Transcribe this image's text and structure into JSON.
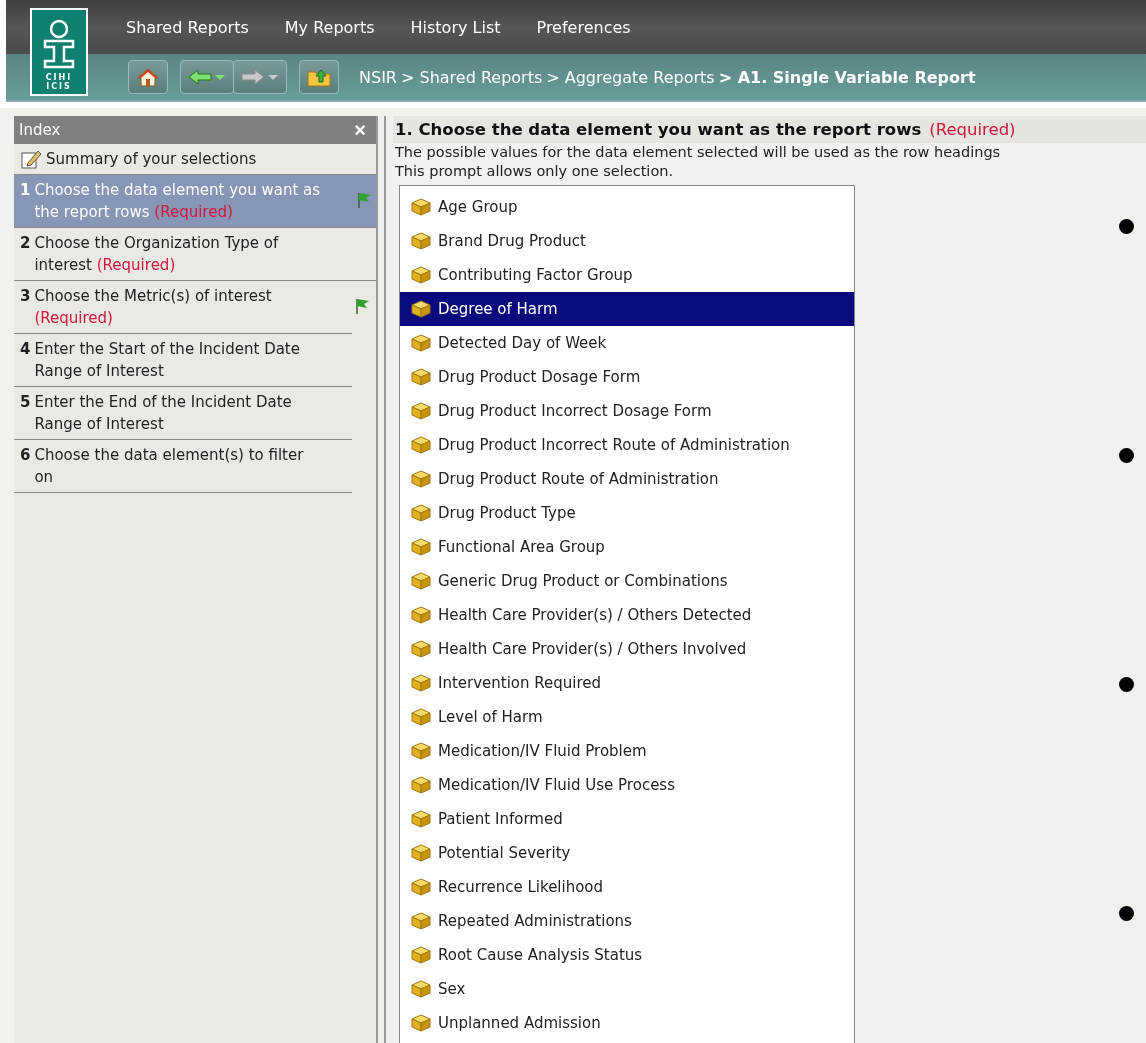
{
  "logo": {
    "lines": [
      "CIHI",
      "ICIS"
    ]
  },
  "nav": {
    "items": [
      {
        "label": "Shared Reports"
      },
      {
        "label": "My Reports"
      },
      {
        "label": "History List"
      },
      {
        "label": "Preferences"
      }
    ]
  },
  "toolbar": {
    "buttons": [
      {
        "kind": "home",
        "disabled": false
      },
      {
        "kind": "back",
        "disabled": false
      },
      {
        "kind": "forward",
        "disabled": true
      },
      {
        "kind": "folder-up",
        "disabled": false
      }
    ]
  },
  "breadcrumb": [
    {
      "label": "NSIR",
      "current": false
    },
    {
      "label": "Shared Reports",
      "prefix": ">",
      "current": false
    },
    {
      "label": "Aggregate Reports",
      "prefix": ">",
      "current": false
    },
    {
      "label": "A1. Single Variable Report",
      "prefix": ">",
      "current": true
    }
  ],
  "index": {
    "title": "Index",
    "close": "×",
    "summary": "Summary of your selections",
    "items": [
      {
        "number": "1",
        "text": "Choose the data element you want as the report rows",
        "required": "(Required)",
        "flagged": true,
        "selected": true
      },
      {
        "number": "2",
        "text": "Choose the Organization Type of interest",
        "required": "(Required)",
        "flagged": false,
        "selected": false
      },
      {
        "number": "3",
        "text": "Choose the Metric(s) of interest",
        "required": "(Required)",
        "flagged": true,
        "selected": false
      },
      {
        "number": "4",
        "text": "Enter the Start of the Incident Date Range of Interest",
        "flagged": false,
        "selected": false
      },
      {
        "number": "5",
        "text": "Enter the End of the Incident Date Range of Interest",
        "flagged": false,
        "selected": false
      },
      {
        "number": "6",
        "text": "Choose the data element(s) to filter on",
        "flagged": false,
        "selected": false
      }
    ]
  },
  "prompt": {
    "title": "1. Choose the data element you want as the report rows",
    "required": "(Required)",
    "descriptions": [
      "The possible values for the data element selected will be used as the row headings",
      "This prompt allows only one selection."
    ],
    "options": [
      {
        "label": "Age Group",
        "selected": false
      },
      {
        "label": "Brand Drug Product",
        "selected": false
      },
      {
        "label": "Contributing Factor Group",
        "selected": false
      },
      {
        "label": "Degree of Harm",
        "selected": true
      },
      {
        "label": "Detected Day of Week",
        "selected": false
      },
      {
        "label": "Drug Product Dosage Form",
        "selected": false
      },
      {
        "label": "Drug Product Incorrect Dosage Form",
        "selected": false
      },
      {
        "label": "Drug Product Incorrect Route of Administration",
        "selected": false
      },
      {
        "label": "Drug Product Route of Administration",
        "selected": false
      },
      {
        "label": "Drug Product Type",
        "selected": false
      },
      {
        "label": "Functional Area Group",
        "selected": false
      },
      {
        "label": "Generic Drug Product or Combinations",
        "selected": false
      },
      {
        "label": "Health Care Provider(s) / Others Detected",
        "selected": false
      },
      {
        "label": "Health Care Provider(s) / Others Involved",
        "selected": false
      },
      {
        "label": "Intervention Required",
        "selected": false
      },
      {
        "label": "Level of Harm",
        "selected": false
      },
      {
        "label": "Medication/IV Fluid Problem",
        "selected": false
      },
      {
        "label": "Medication/IV Fluid Use Process",
        "selected": false
      },
      {
        "label": "Patient Informed",
        "selected": false
      },
      {
        "label": "Potential Severity",
        "selected": false
      },
      {
        "label": "Recurrence Likelihood",
        "selected": false
      },
      {
        "label": "Repeated Administrations",
        "selected": false
      },
      {
        "label": "Root Cause Analysis Status",
        "selected": false
      },
      {
        "label": "Sex",
        "selected": false
      },
      {
        "label": "Unplanned Admission",
        "selected": false
      }
    ]
  }
}
